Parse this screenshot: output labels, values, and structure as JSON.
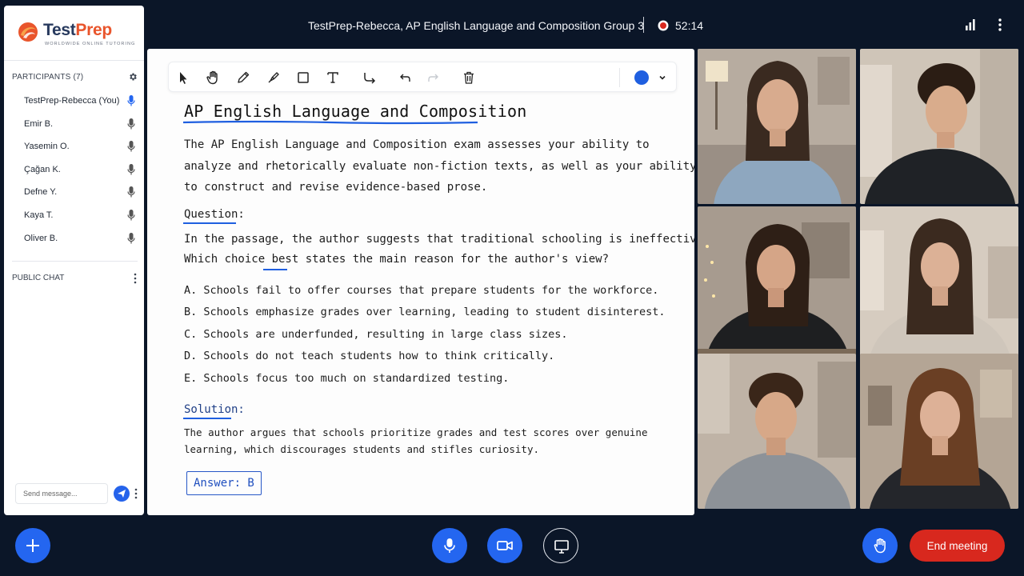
{
  "brand": {
    "name_part1": "Test",
    "name_part2": "Prep",
    "tagline": "WORLDWIDE ONLINE TUTORING",
    "colors": {
      "orange": "#e9552c",
      "navy": "#283a5e"
    }
  },
  "sidebar": {
    "participants_title": "PARTICIPANTS (7)",
    "participants": [
      {
        "name": "TestPrep-Rebecca (You)",
        "mic_active": true
      },
      {
        "name": "Emir B.",
        "mic_active": false
      },
      {
        "name": "Yasemin O.",
        "mic_active": false
      },
      {
        "name": "Çağan K.",
        "mic_active": false
      },
      {
        "name": "Defne Y.",
        "mic_active": false
      },
      {
        "name": "Kaya T.",
        "mic_active": false
      },
      {
        "name": "Oliver B.",
        "mic_active": false
      }
    ],
    "chat_title": "PUBLIC CHAT",
    "chat_placeholder": "Send message..."
  },
  "topbar": {
    "meeting_title": "TestPrep-Rebecca, AP English Language and Composition Group 3",
    "recording_time": "52:14"
  },
  "toolbar": {
    "tools": [
      "select-tool-icon",
      "hand-tool-icon",
      "pencil-tool-icon",
      "marker-tool-icon",
      "rectangle-tool-icon",
      "text-tool-icon",
      "connector-tool-icon",
      "undo-icon",
      "redo-icon",
      "trash-icon"
    ],
    "selected_color": "#1f5fe0"
  },
  "whiteboard": {
    "title": "AP English Language and Composition",
    "intro": [
      "The AP English Language and Composition exam assesses your ability to",
      "analyze and rhetorically evaluate non-fiction texts, as well as your ability",
      "to construct and revise evidence-based prose."
    ],
    "question_label": "Question:",
    "question": [
      "In the passage, the author suggests that traditional schooling is ineffective.",
      "Which choice best states the main reason for the author's view?"
    ],
    "options": [
      "A.  Schools fail to offer courses that prepare students for the workforce.",
      "B.  Schools emphasize grades over learning, leading to student disinterest.",
      "C.  Schools are underfunded, resulting in large class sizes.",
      "D.  Schools do not teach students how to think critically.",
      "E.  Schools focus too much on standardized testing."
    ],
    "solution_label": "Solution:",
    "solution": [
      "The author argues that schools prioritize grades and test scores over genuine",
      "learning, which discourages students and stifles curiosity."
    ],
    "answer": "Answer: B"
  },
  "controls": {
    "end_meeting_label": "End meeting",
    "accent": "#2466f0",
    "danger": "#d8281e"
  }
}
